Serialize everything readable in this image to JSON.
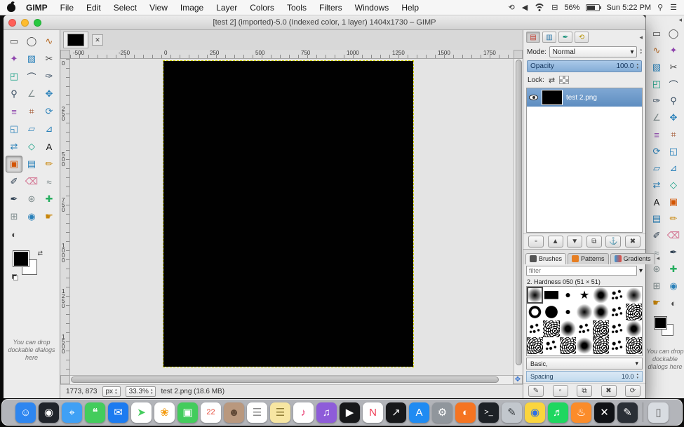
{
  "menu_bar": {
    "items": [
      "GIMP",
      "File",
      "Edit",
      "Select",
      "View",
      "Image",
      "Layer",
      "Colors",
      "Tools",
      "Filters",
      "Windows",
      "Help"
    ],
    "status_icons_left": [
      {
        "name": "time-machine-icon",
        "glyph": "⟲"
      },
      {
        "name": "volume-icon",
        "glyph": "◀"
      },
      {
        "name": "wifi-icon",
        "glyph": "wifi"
      },
      {
        "name": "display-icon",
        "glyph": "⊟"
      }
    ],
    "battery": "56%",
    "clock": "Sun 5:22 PM",
    "status_icons_right": [
      {
        "name": "spotlight-icon",
        "glyph": "⚲"
      },
      {
        "name": "notification-center-icon",
        "glyph": "☰"
      }
    ]
  },
  "window": {
    "title": "[test 2] (imported)-5.0 (Indexed color, 1 layer) 1404x1730 – GIMP"
  },
  "ui": {
    "dropdown": "▾",
    "spin_up": "▴",
    "spin_down": "▾",
    "panel_close": "◂",
    "tab_close": "✕",
    "nav": "✥",
    "swap": "⇄"
  },
  "left_toolbox": {
    "active_tool": "bucket-fill-tool",
    "fg_color": "#000000",
    "bg_color": "#ffffff",
    "drop_hint": "You can drop dockable dialogs here",
    "tools": [
      {
        "name": "rectangle-select-tool",
        "glyph": "▭",
        "color": "#4a4a4a"
      },
      {
        "name": "ellipse-select-tool",
        "glyph": "◯",
        "color": "#4a4a4a"
      },
      {
        "name": "free-select-tool",
        "glyph": "∿",
        "color": "#b5651d"
      },
      {
        "name": "fuzzy-select-tool",
        "glyph": "✦",
        "color": "#8e44ad"
      },
      {
        "name": "select-by-color-tool",
        "glyph": "▧",
        "color": "#2980b9"
      },
      {
        "name": "scissors-select-tool",
        "glyph": "✂",
        "color": "#4a4a4a"
      },
      {
        "name": "foreground-select-tool",
        "glyph": "◰",
        "color": "#16a085"
      },
      {
        "name": "paths-tool",
        "glyph": "⌒",
        "color": "#2c3e50"
      },
      {
        "name": "color-picker-tool",
        "glyph": "✑",
        "color": "#34495e"
      },
      {
        "name": "zoom-tool",
        "glyph": "⚲",
        "color": "#34495e"
      },
      {
        "name": "measure-tool",
        "glyph": "∠",
        "color": "#7f8c8d"
      },
      {
        "name": "move-tool",
        "glyph": "✥",
        "color": "#2980b9"
      },
      {
        "name": "align-tool",
        "glyph": "≡",
        "color": "#8e44ad"
      },
      {
        "name": "crop-tool",
        "glyph": "⌗",
        "color": "#a0522d"
      },
      {
        "name": "rotate-tool",
        "glyph": "⟳",
        "color": "#2980b9"
      },
      {
        "name": "scale-tool",
        "glyph": "◱",
        "color": "#2980b9"
      },
      {
        "name": "shear-tool",
        "glyph": "▱",
        "color": "#2980b9"
      },
      {
        "name": "perspective-tool",
        "glyph": "⊿",
        "color": "#2980b9"
      },
      {
        "name": "flip-tool",
        "glyph": "⇄",
        "color": "#2980b9"
      },
      {
        "name": "cage-transform-tool",
        "glyph": "◇",
        "color": "#16a085"
      },
      {
        "name": "text-tool",
        "glyph": "A",
        "color": "#1a1a1a"
      },
      {
        "name": "bucket-fill-tool",
        "glyph": "▣",
        "color": "#d35400"
      },
      {
        "name": "blend-tool",
        "glyph": "▤",
        "color": "#2980b9"
      },
      {
        "name": "pencil-tool",
        "glyph": "✏",
        "color": "#c8860a"
      },
      {
        "name": "paintbrush-tool",
        "glyph": "✐",
        "color": "#2c3e50"
      },
      {
        "name": "eraser-tool",
        "glyph": "⌫",
        "color": "#d16a8a"
      },
      {
        "name": "airbrush-tool",
        "glyph": "≈",
        "color": "#7f8c8d"
      },
      {
        "name": "ink-tool",
        "glyph": "✒",
        "color": "#2c3e50"
      },
      {
        "name": "clone-tool",
        "glyph": "⊛",
        "color": "#7f8c8d"
      },
      {
        "name": "heal-tool",
        "glyph": "✚",
        "color": "#27ae60"
      },
      {
        "name": "perspective-clone-tool",
        "glyph": "⊞",
        "color": "#7f8c8d"
      },
      {
        "name": "blur-sharpen-tool",
        "glyph": "◉",
        "color": "#2980b9"
      },
      {
        "name": "smudge-tool",
        "glyph": "☛",
        "color": "#c8860a"
      },
      {
        "name": "dodge-burn-tool",
        "glyph": "◐",
        "color": "#4a4a4a"
      }
    ]
  },
  "canvas_area": {
    "h_ruler": [
      "-500",
      "-250",
      "0",
      "250",
      "500",
      "750",
      "1000",
      "1250",
      "1500",
      "1750"
    ],
    "v_ruler": [
      "0",
      "250",
      "500",
      "750",
      "1000",
      "1250",
      "1500"
    ],
    "status": {
      "position": "1773, 873",
      "unit": "px",
      "zoom": "33.3%",
      "file_label": "test 2.png (18.6 MB)"
    }
  },
  "layers_panel": {
    "dialog_tabs": [
      {
        "name": "layers-tab",
        "glyph": "▤",
        "color": "#c0392b",
        "active": true
      },
      {
        "name": "channels-tab",
        "glyph": "▥",
        "color": "#2471a3",
        "active": false
      },
      {
        "name": "paths-tab",
        "glyph": "✒",
        "color": "#148f77",
        "active": false
      },
      {
        "name": "undo-history-tab",
        "glyph": "⟲",
        "color": "#b7950b",
        "active": false
      }
    ],
    "mode_label": "Mode:",
    "mode_value": "Normal",
    "opacity_label": "Opacity",
    "opacity_value": "100.0",
    "lock_label": "Lock:",
    "layer": {
      "name": "test 2.png"
    },
    "buttons": [
      {
        "name": "new-layer-button",
        "glyph": "▫"
      },
      {
        "name": "raise-layer-button",
        "glyph": "▲"
      },
      {
        "name": "lower-layer-button",
        "glyph": "▼"
      },
      {
        "name": "duplicate-layer-button",
        "glyph": "⧉"
      },
      {
        "name": "anchor-layer-button",
        "glyph": "⚓"
      },
      {
        "name": "delete-layer-button",
        "glyph": "✖"
      }
    ]
  },
  "brushes_panel": {
    "tabs": [
      {
        "name": "tab-brushes",
        "label": "Brushes",
        "color": "#555555",
        "active": true
      },
      {
        "name": "tab-patterns",
        "label": "Patterns",
        "color": "#e67e22",
        "active": false
      },
      {
        "name": "tab-gradients",
        "label": "Gradients",
        "color": "gradient",
        "active": false
      }
    ],
    "filter_placeholder": "filter",
    "selected_label": "2. Hardness 050 (51 × 51)",
    "selected_index": 0,
    "brushes": [
      {
        "kind": "soft"
      },
      {
        "kind": "bar"
      },
      {
        "kind": "dot"
      },
      {
        "kind": "star"
      },
      {
        "kind": "blob"
      },
      {
        "kind": "spray"
      },
      {
        "kind": "soft"
      },
      {
        "kind": "ring"
      },
      {
        "kind": "hard"
      },
      {
        "kind": "dot"
      },
      {
        "kind": "soft"
      },
      {
        "kind": "blob"
      },
      {
        "kind": "spray"
      },
      {
        "kind": "texture"
      },
      {
        "kind": "spray"
      },
      {
        "kind": "texture"
      },
      {
        "kind": "blob"
      },
      {
        "kind": "spray"
      },
      {
        "kind": "texture"
      },
      {
        "kind": "spray"
      },
      {
        "kind": "blob"
      },
      {
        "kind": "texture"
      },
      {
        "kind": "spray"
      },
      {
        "kind": "texture"
      },
      {
        "kind": "blob"
      },
      {
        "kind": "texture"
      },
      {
        "kind": "spray"
      },
      {
        "kind": "texture"
      }
    ],
    "group_value": "Basic,",
    "spacing_label": "Spacing",
    "spacing_value": "10.0",
    "buttons": [
      {
        "name": "edit-brush-button",
        "glyph": "✎"
      },
      {
        "name": "new-brush-button",
        "glyph": "▫"
      },
      {
        "name": "duplicate-brush-button",
        "glyph": "⧉"
      },
      {
        "name": "delete-brush-button",
        "glyph": "✖"
      },
      {
        "name": "refresh-brushes-button",
        "glyph": "⟳"
      }
    ]
  },
  "right_strip": {
    "drop_hint": "You can drop dockable dialogs here"
  },
  "dock": {
    "apps": [
      {
        "name": "finder",
        "glyph": "☺",
        "bg": "#2e86f0"
      },
      {
        "name": "siri",
        "glyph": "◉",
        "bg": "#20242b"
      },
      {
        "name": "safari",
        "glyph": "⌖",
        "bg": "#3fa0f5"
      },
      {
        "name": "messages",
        "glyph": "❝",
        "bg": "#43cc5c"
      },
      {
        "name": "mail",
        "glyph": "✉",
        "bg": "#1c7bf0"
      },
      {
        "name": "maps",
        "glyph": "➤",
        "bg": "#ffffff",
        "fg": "#43cc5c"
      },
      {
        "name": "photos",
        "glyph": "❀",
        "bg": "#ffffff",
        "fg": "#f39c12"
      },
      {
        "name": "facetime",
        "glyph": "▣",
        "bg": "#43cc5c"
      },
      {
        "name": "calendar",
        "glyph": "22",
        "bg": "#ffffff",
        "fg": "#e74c3c"
      },
      {
        "name": "contacts",
        "glyph": "☻",
        "bg": "#b9987e",
        "fg": "#5d4634"
      },
      {
        "name": "reminders",
        "glyph": "☰",
        "bg": "#ffffff",
        "fg": "#888888"
      },
      {
        "name": "notes",
        "glyph": "☰",
        "bg": "#f7e6a2",
        "fg": "#8d7a33"
      },
      {
        "name": "itunes",
        "glyph": "♪",
        "bg": "#ffffff",
        "fg": "#e8356d"
      },
      {
        "name": "podcasts",
        "glyph": "♫",
        "bg": "#8e5cd9"
      },
      {
        "name": "tv",
        "glyph": "▶",
        "bg": "#17181a"
      },
      {
        "name": "news",
        "glyph": "N",
        "bg": "#ffffff",
        "fg": "#ef3e57"
      },
      {
        "name": "stocks",
        "glyph": "↗",
        "bg": "#17181a"
      },
      {
        "name": "app-store",
        "glyph": "A",
        "bg": "#1f8bf2"
      },
      {
        "name": "system-preferences",
        "glyph": "⚙",
        "bg": "#90969c"
      },
      {
        "name": "firefox",
        "glyph": "◐",
        "bg": "#f57421"
      },
      {
        "name": "terminal",
        "glyph": ">_",
        "bg": "#1d2126"
      },
      {
        "name": "gimp",
        "glyph": "✎",
        "bg": "#c2c7cd",
        "fg": "#3a3f44"
      },
      {
        "name": "chrome",
        "glyph": "◉",
        "bg": "#fbd53e",
        "fg": "#2f6fe4"
      },
      {
        "name": "spotify",
        "glyph": "♬",
        "bg": "#1ed760"
      },
      {
        "name": "flame-app",
        "glyph": "♨",
        "bg": "#fb8c2a"
      },
      {
        "name": "x11",
        "glyph": "✕",
        "bg": "#101216"
      },
      {
        "name": "pen-app",
        "glyph": "✎",
        "bg": "#2a2f36"
      },
      {
        "divider": true
      },
      {
        "name": "trash",
        "glyph": "▯",
        "bg": "#d8dce1",
        "fg": "#666666"
      }
    ]
  }
}
